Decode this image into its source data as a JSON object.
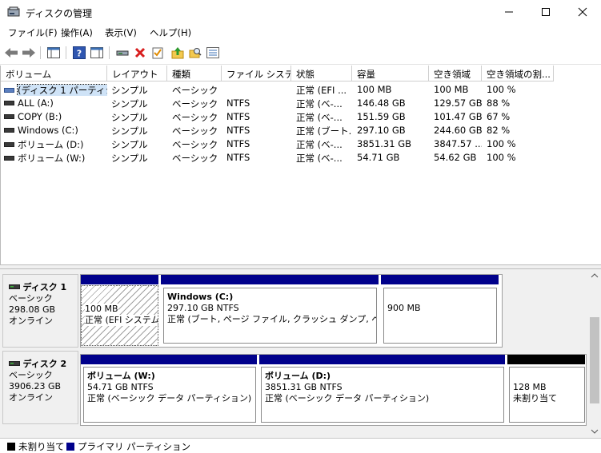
{
  "window": {
    "title": "ディスクの管理"
  },
  "menu": [
    "ファイル(F)",
    "操作(A)",
    "表示(V)",
    "ヘルプ(H)"
  ],
  "columns": [
    "ボリューム",
    "レイアウト",
    "種類",
    "ファイル システム",
    "状態",
    "容量",
    "空き領域",
    "空き領域の割..."
  ],
  "volumes": [
    {
      "name": "(ディスク 1 パーティシ...",
      "layout": "シンプル",
      "type": "ベーシック",
      "fs": "",
      "status": "正常 (EFI ...",
      "capacity": "100 MB",
      "free": "100 MB",
      "pct": "100 %"
    },
    {
      "name": "ALL (A:)",
      "layout": "シンプル",
      "type": "ベーシック",
      "fs": "NTFS",
      "status": "正常 (ベ-...",
      "capacity": "146.48 GB",
      "free": "129.57 GB",
      "pct": "88 %"
    },
    {
      "name": "COPY (B:)",
      "layout": "シンプル",
      "type": "ベーシック",
      "fs": "NTFS",
      "status": "正常 (ベ-...",
      "capacity": "151.59 GB",
      "free": "101.47 GB",
      "pct": "67 %"
    },
    {
      "name": "Windows (C:)",
      "layout": "シンプル",
      "type": "ベーシック",
      "fs": "NTFS",
      "status": "正常 (ブート...",
      "capacity": "297.10 GB",
      "free": "244.60 GB",
      "pct": "82 %"
    },
    {
      "name": "ボリューム (D:)",
      "layout": "シンプル",
      "type": "ベーシック",
      "fs": "NTFS",
      "status": "正常 (ベ-...",
      "capacity": "3851.31 GB",
      "free": "3847.57 ...",
      "pct": "100 %"
    },
    {
      "name": "ボリューム (W:)",
      "layout": "シンプル",
      "type": "ベーシック",
      "fs": "NTFS",
      "status": "正常 (ベ-...",
      "capacity": "54.71 GB",
      "free": "54.62 GB",
      "pct": "100 %"
    }
  ],
  "disks": [
    {
      "name": "ディスク 1",
      "kind": "ベーシック",
      "size": "298.08 GB",
      "state": "オンライン",
      "parts": [
        {
          "title": "",
          "line1": "100 MB",
          "line2": "正常 (EFI システム"
        },
        {
          "title": "Windows (C:)",
          "line1": "297.10 GB NTFS",
          "line2": "正常 (ブート, ページ ファイル, クラッシュ ダンプ, ベーシック"
        },
        {
          "title": "",
          "line1": "900 MB",
          "line2": ""
        }
      ]
    },
    {
      "name": "ディスク 2",
      "kind": "ベーシック",
      "size": "3906.23 GB",
      "state": "オンライン",
      "parts": [
        {
          "title": "ボリューム (W:)",
          "line1": "54.71 GB NTFS",
          "line2": "正常 (ベーシック データ パーティション)"
        },
        {
          "title": "ボリューム (D:)",
          "line1": "3851.31 GB NTFS",
          "line2": "正常 (ベーシック データ パーティション)"
        },
        {
          "title": "",
          "line1": "128 MB",
          "line2": "未割り当て"
        }
      ]
    }
  ],
  "legend": {
    "unallocated": "未割り当て",
    "primary": "プライマリ パーティション"
  },
  "colors": {
    "primary": "#00008b",
    "unallocated": "#000000",
    "selection": "#cfe3f7"
  }
}
